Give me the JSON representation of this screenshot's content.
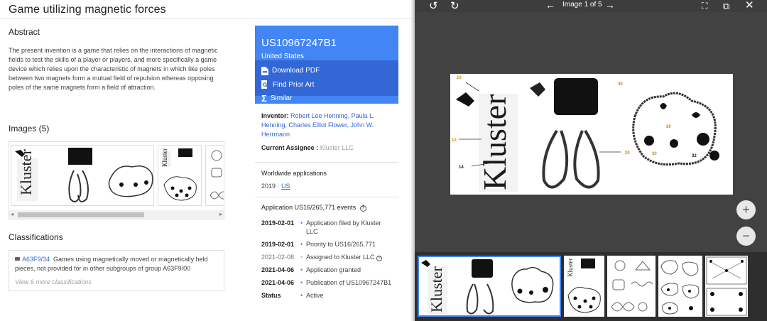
{
  "title": "Game utilizing magnetic forces",
  "abstract": {
    "heading": "Abstract",
    "text": "The present invention is a game that relies on the interactions of magnetic fields to test the skills of a player or players, and more specifically a game device which relies upon the characteristic of magnets in which like poles between two magnets form a mutual field of repulsion whereas opposing poles of the same magnets form a field of attraction."
  },
  "images": {
    "heading": "Images (5)"
  },
  "classifications": {
    "heading": "Classifications",
    "code": "A63F9/34",
    "description": "Games using magnetically moved or magnetically held pieces, not provided for in other subgroups of group A63F9/00",
    "more": "View 6 more classifications"
  },
  "sidebar": {
    "pub_number": "US10967247B1",
    "country": "United States",
    "download_pdf": "Download PDF",
    "find_prior_art": "Find Prior Art",
    "similar": "Similar",
    "inventor_label": "Inventor:",
    "inventors": "Robert Lee Henning, Paula L. Henning, Charles Elliot Flower, John W. Herrmann",
    "assignee_label": "Current Assignee :",
    "assignee": "Kluster LLC",
    "worldwide_label": "Worldwide applications",
    "worldwide_year": "2019",
    "worldwide_country": "US",
    "events_label": "Application US16/265,771 events",
    "events": [
      {
        "date": "2019-02-01",
        "text": "Application filed by Kluster LLC",
        "grey": false
      },
      {
        "date": "2019-02-01",
        "text": "Priority to US16/265,771",
        "grey": false
      },
      {
        "date": "2021-02-08",
        "text": "Assigned to Kluster LLC",
        "grey": true
      },
      {
        "date": "2021-04-06",
        "text": "Application granted",
        "grey": false
      },
      {
        "date": "2021-04-06",
        "text": "Publication of US10967247B1",
        "grey": false
      },
      {
        "date": "Status",
        "text": "Active",
        "grey": false
      }
    ]
  },
  "viewer": {
    "label": "Image 1 of 5",
    "zoom_in": "+",
    "zoom_out": "−",
    "figure_labels": [
      "10",
      "30",
      "20",
      "20",
      "12",
      "30",
      "32",
      "14"
    ]
  },
  "colors": {
    "accent": "#4285f4",
    "accent_dark": "#3367d6",
    "viewer_bg": "#424242"
  }
}
